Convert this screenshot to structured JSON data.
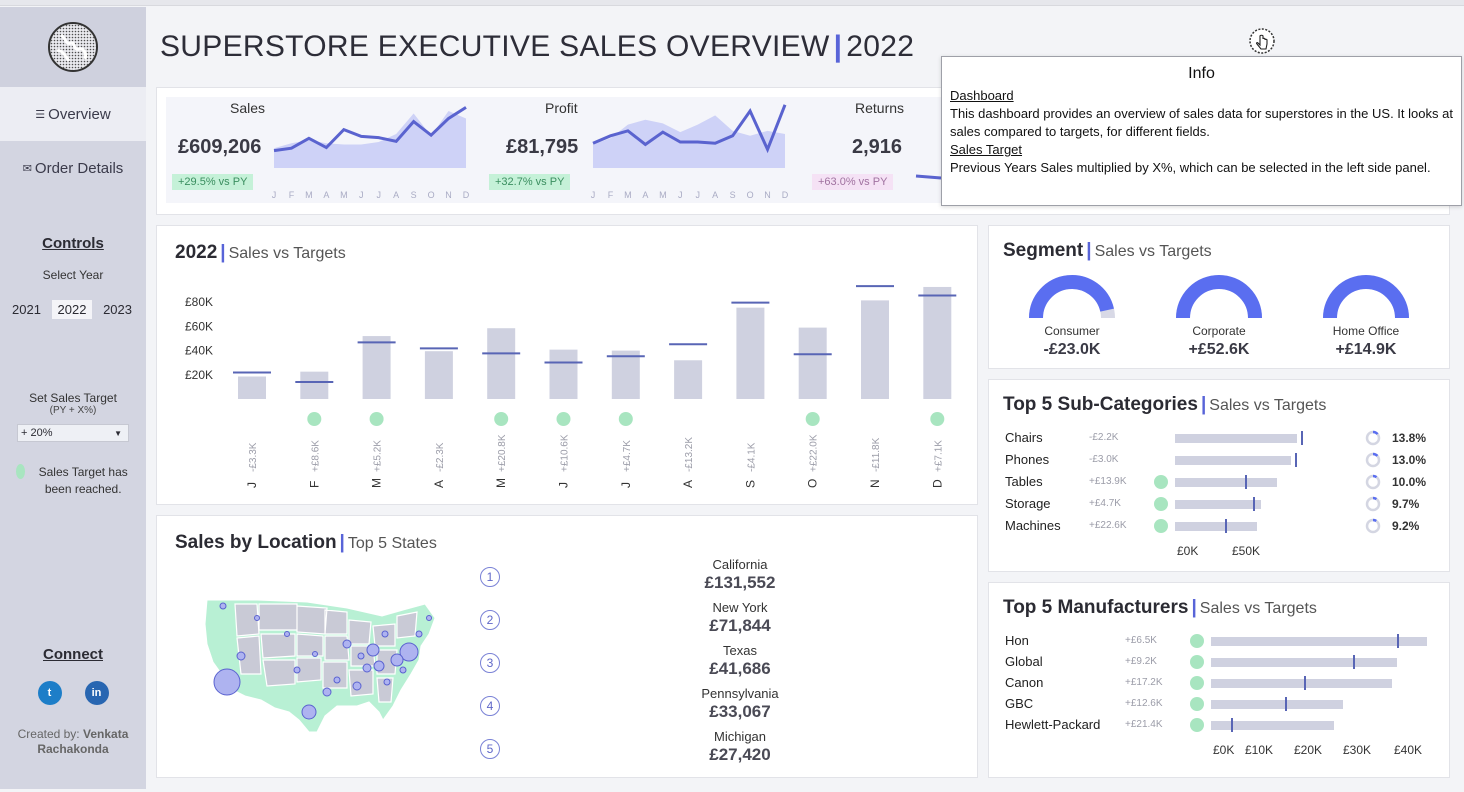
{
  "sidebar": {
    "nav": [
      {
        "icon": "menu-icon",
        "label": "Overview",
        "active": true
      },
      {
        "icon": "mail-icon",
        "label": "Order Details",
        "active": false
      }
    ],
    "controls_title": "Controls",
    "select_year_label": "Select Year",
    "years": [
      "2021",
      "2022",
      "2023"
    ],
    "selected_year": "2022",
    "sales_target_label": "Set Sales Target",
    "sales_target_sub": "(PY + X%)",
    "sales_target_value": "+ 20%",
    "legend_text": "Sales Target has been reached.",
    "connect_title": "Connect",
    "social": [
      {
        "icon": "twitter-icon",
        "label": "t"
      },
      {
        "icon": "linkedin-icon",
        "label": "in"
      }
    ],
    "created_by_prefix": "Created by:",
    "created_by_name_1": "Venkata",
    "created_by_name_2": "Rachakonda"
  },
  "header": {
    "title": "SUPERSTORE EXECUTIVE SALES OVERVIEW",
    "separator": "|",
    "year": "2022"
  },
  "kpis": [
    {
      "label": "Sales",
      "value": "£609,206",
      "badge": "+29.5% vs PY",
      "badge_color": "green"
    },
    {
      "label": "Profit",
      "value": "£81,795",
      "badge": "+32.7% vs PY",
      "badge_color": "green"
    },
    {
      "label": "Returns",
      "value": "2,916",
      "badge": "+63.0% vs PY",
      "badge_color": "pink"
    }
  ],
  "kpi_month_letters": [
    "J",
    "F",
    "M",
    "A",
    "M",
    "J",
    "J",
    "A",
    "S",
    "O",
    "N",
    "D"
  ],
  "info": {
    "title": "Info",
    "h1": "Dashboard",
    "p1": "This dashboard provides an overview of sales data for superstores in the US. It looks at sales compared to targets, for different fields.",
    "h2": "Sales Target",
    "p2": "Previous Years Sales multiplied by X%, which can be selected in the left side panel."
  },
  "monthly_panel": {
    "title_bold": "2022",
    "sep": "|",
    "title_sub": "Sales vs Targets"
  },
  "segment_panel": {
    "title_bold": "Segment",
    "sep": "|",
    "title_sub": "Sales vs Targets",
    "segments": [
      {
        "name": "Consumer",
        "diff": "-£23.0K",
        "fill": 0.93
      },
      {
        "name": "Corporate",
        "diff": "+£52.6K",
        "fill": 1.0
      },
      {
        "name": "Home Office",
        "diff": "+£14.9K",
        "fill": 1.0
      }
    ]
  },
  "subcat_panel": {
    "title_bold": "Top 5 Sub-Categories",
    "sep": "|",
    "title_sub": "Sales vs Targets",
    "rows": [
      {
        "name": "Chairs",
        "diff": "-£2.2K",
        "reached": false,
        "sales": 61,
        "target": 63,
        "pct": "13.8%",
        "share": 0.138
      },
      {
        "name": "Phones",
        "diff": "-£3.0K",
        "reached": false,
        "sales": 58,
        "target": 60,
        "pct": "13.0%",
        "share": 0.13
      },
      {
        "name": "Tables",
        "diff": "+£13.9K",
        "reached": true,
        "sales": 51,
        "target": 35,
        "pct": "10.0%",
        "share": 0.1
      },
      {
        "name": "Storage",
        "diff": "+£4.7K",
        "reached": true,
        "sales": 43,
        "target": 39,
        "pct": "9.7%",
        "share": 0.097
      },
      {
        "name": "Machines",
        "diff": "+£22.6K",
        "reached": true,
        "sales": 41,
        "target": 25,
        "pct": "9.2%",
        "share": 0.092
      }
    ],
    "axis": [
      "£0K",
      "£50K"
    ]
  },
  "manuf_panel": {
    "title_bold": "Top 5 Manufacturers",
    "sep": "|",
    "title_sub": "Sales vs Targets",
    "rows": [
      {
        "name": "Hon",
        "diff": "+£6.5K",
        "reached": true,
        "sales": 44,
        "target": 38
      },
      {
        "name": "Global",
        "diff": "+£9.2K",
        "reached": true,
        "sales": 38,
        "target": 29
      },
      {
        "name": "Canon",
        "diff": "+£17.2K",
        "reached": true,
        "sales": 37,
        "target": 19
      },
      {
        "name": "GBC",
        "diff": "+£12.6K",
        "reached": true,
        "sales": 27,
        "target": 15
      },
      {
        "name": "Hewlett-Packard",
        "diff": "+£21.4K",
        "reached": true,
        "sales": 25,
        "target": 4
      }
    ],
    "axis": [
      "£0K",
      "£10K",
      "£20K",
      "£30K",
      "£40K"
    ]
  },
  "location_panel": {
    "title_bold": "Sales by Location",
    "sep": "|",
    "title_sub": "Top 5 States",
    "states": [
      {
        "rank": "1",
        "name": "California",
        "value": "£131,552"
      },
      {
        "rank": "2",
        "name": "New York",
        "value": "£71,844"
      },
      {
        "rank": "3",
        "name": "Texas",
        "value": "£41,686"
      },
      {
        "rank": "4",
        "name": "Pennsylvania",
        "value": "£33,067"
      },
      {
        "rank": "5",
        "name": "Michigan",
        "value": "£27,420"
      }
    ]
  },
  "chart_data": [
    {
      "type": "bar",
      "title": "2022 | Sales vs Targets",
      "categories": [
        "J",
        "F",
        "M",
        "A",
        "M",
        "J",
        "J",
        "A",
        "S",
        "O",
        "N",
        "D"
      ],
      "series": [
        {
          "name": "Sales",
          "values": [
            18.6,
            22.6,
            52.0,
            39.5,
            58.5,
            40.8,
            40.0,
            32.0,
            75.5,
            59.0,
            81.5,
            92.6
          ]
        },
        {
          "name": "Target",
          "values": [
            21.9,
            14.0,
            46.8,
            41.8,
            37.7,
            30.2,
            35.3,
            45.2,
            79.6,
            37.0,
            93.3,
            85.5
          ]
        }
      ],
      "diff_labels": [
        "-£3.3K",
        "+£8.6K",
        "+£5.2K",
        "-£2.3K",
        "+£20.8K",
        "+£10.6K",
        "+£4.7K",
        "-£13.2K",
        "-£4.1K",
        "+£22.0K",
        "-£11.8K",
        "+£7.1K"
      ],
      "target_reached": [
        false,
        true,
        true,
        false,
        true,
        true,
        true,
        false,
        false,
        true,
        false,
        true
      ],
      "ytick_labels": [
        "£20K",
        "£40K",
        "£60K",
        "£80K"
      ],
      "yticks": [
        20,
        40,
        60,
        80
      ],
      "ylim": [
        0,
        100
      ],
      "grid": false
    },
    {
      "type": "area",
      "title": "Sales",
      "categories": [
        "J",
        "F",
        "M",
        "A",
        "M",
        "J",
        "J",
        "A",
        "S",
        "O",
        "N",
        "D"
      ],
      "series": [
        {
          "name": "2022",
          "values": [
            28,
            32,
            48,
            33,
            62,
            51,
            49,
            43,
            75,
            53,
            80,
            98
          ]
        },
        {
          "name": "PY",
          "values": [
            32,
            40,
            45,
            40,
            38,
            38,
            42,
            55,
            88,
            52,
            92,
            80
          ]
        }
      ]
    },
    {
      "type": "area",
      "title": "Profit",
      "categories": [
        "J",
        "F",
        "M",
        "A",
        "M",
        "J",
        "J",
        "A",
        "S",
        "O",
        "N",
        "D"
      ],
      "series": [
        {
          "name": "2022",
          "values": [
            40,
            52,
            60,
            38,
            58,
            42,
            42,
            40,
            52,
            92,
            30,
            102
          ]
        },
        {
          "name": "PY",
          "values": [
            38,
            48,
            70,
            78,
            72,
            58,
            70,
            85,
            60,
            52,
            60,
            55
          ]
        }
      ]
    }
  ],
  "colors": {
    "accent": "#5864d8",
    "bar": "#cfd1e0",
    "target": "#5865b5",
    "reached": "#a8e5c0",
    "sidebar": "#d3d5e1",
    "gauge": "#5a6ef0",
    "gauge_bg": "#d8d9e6"
  }
}
